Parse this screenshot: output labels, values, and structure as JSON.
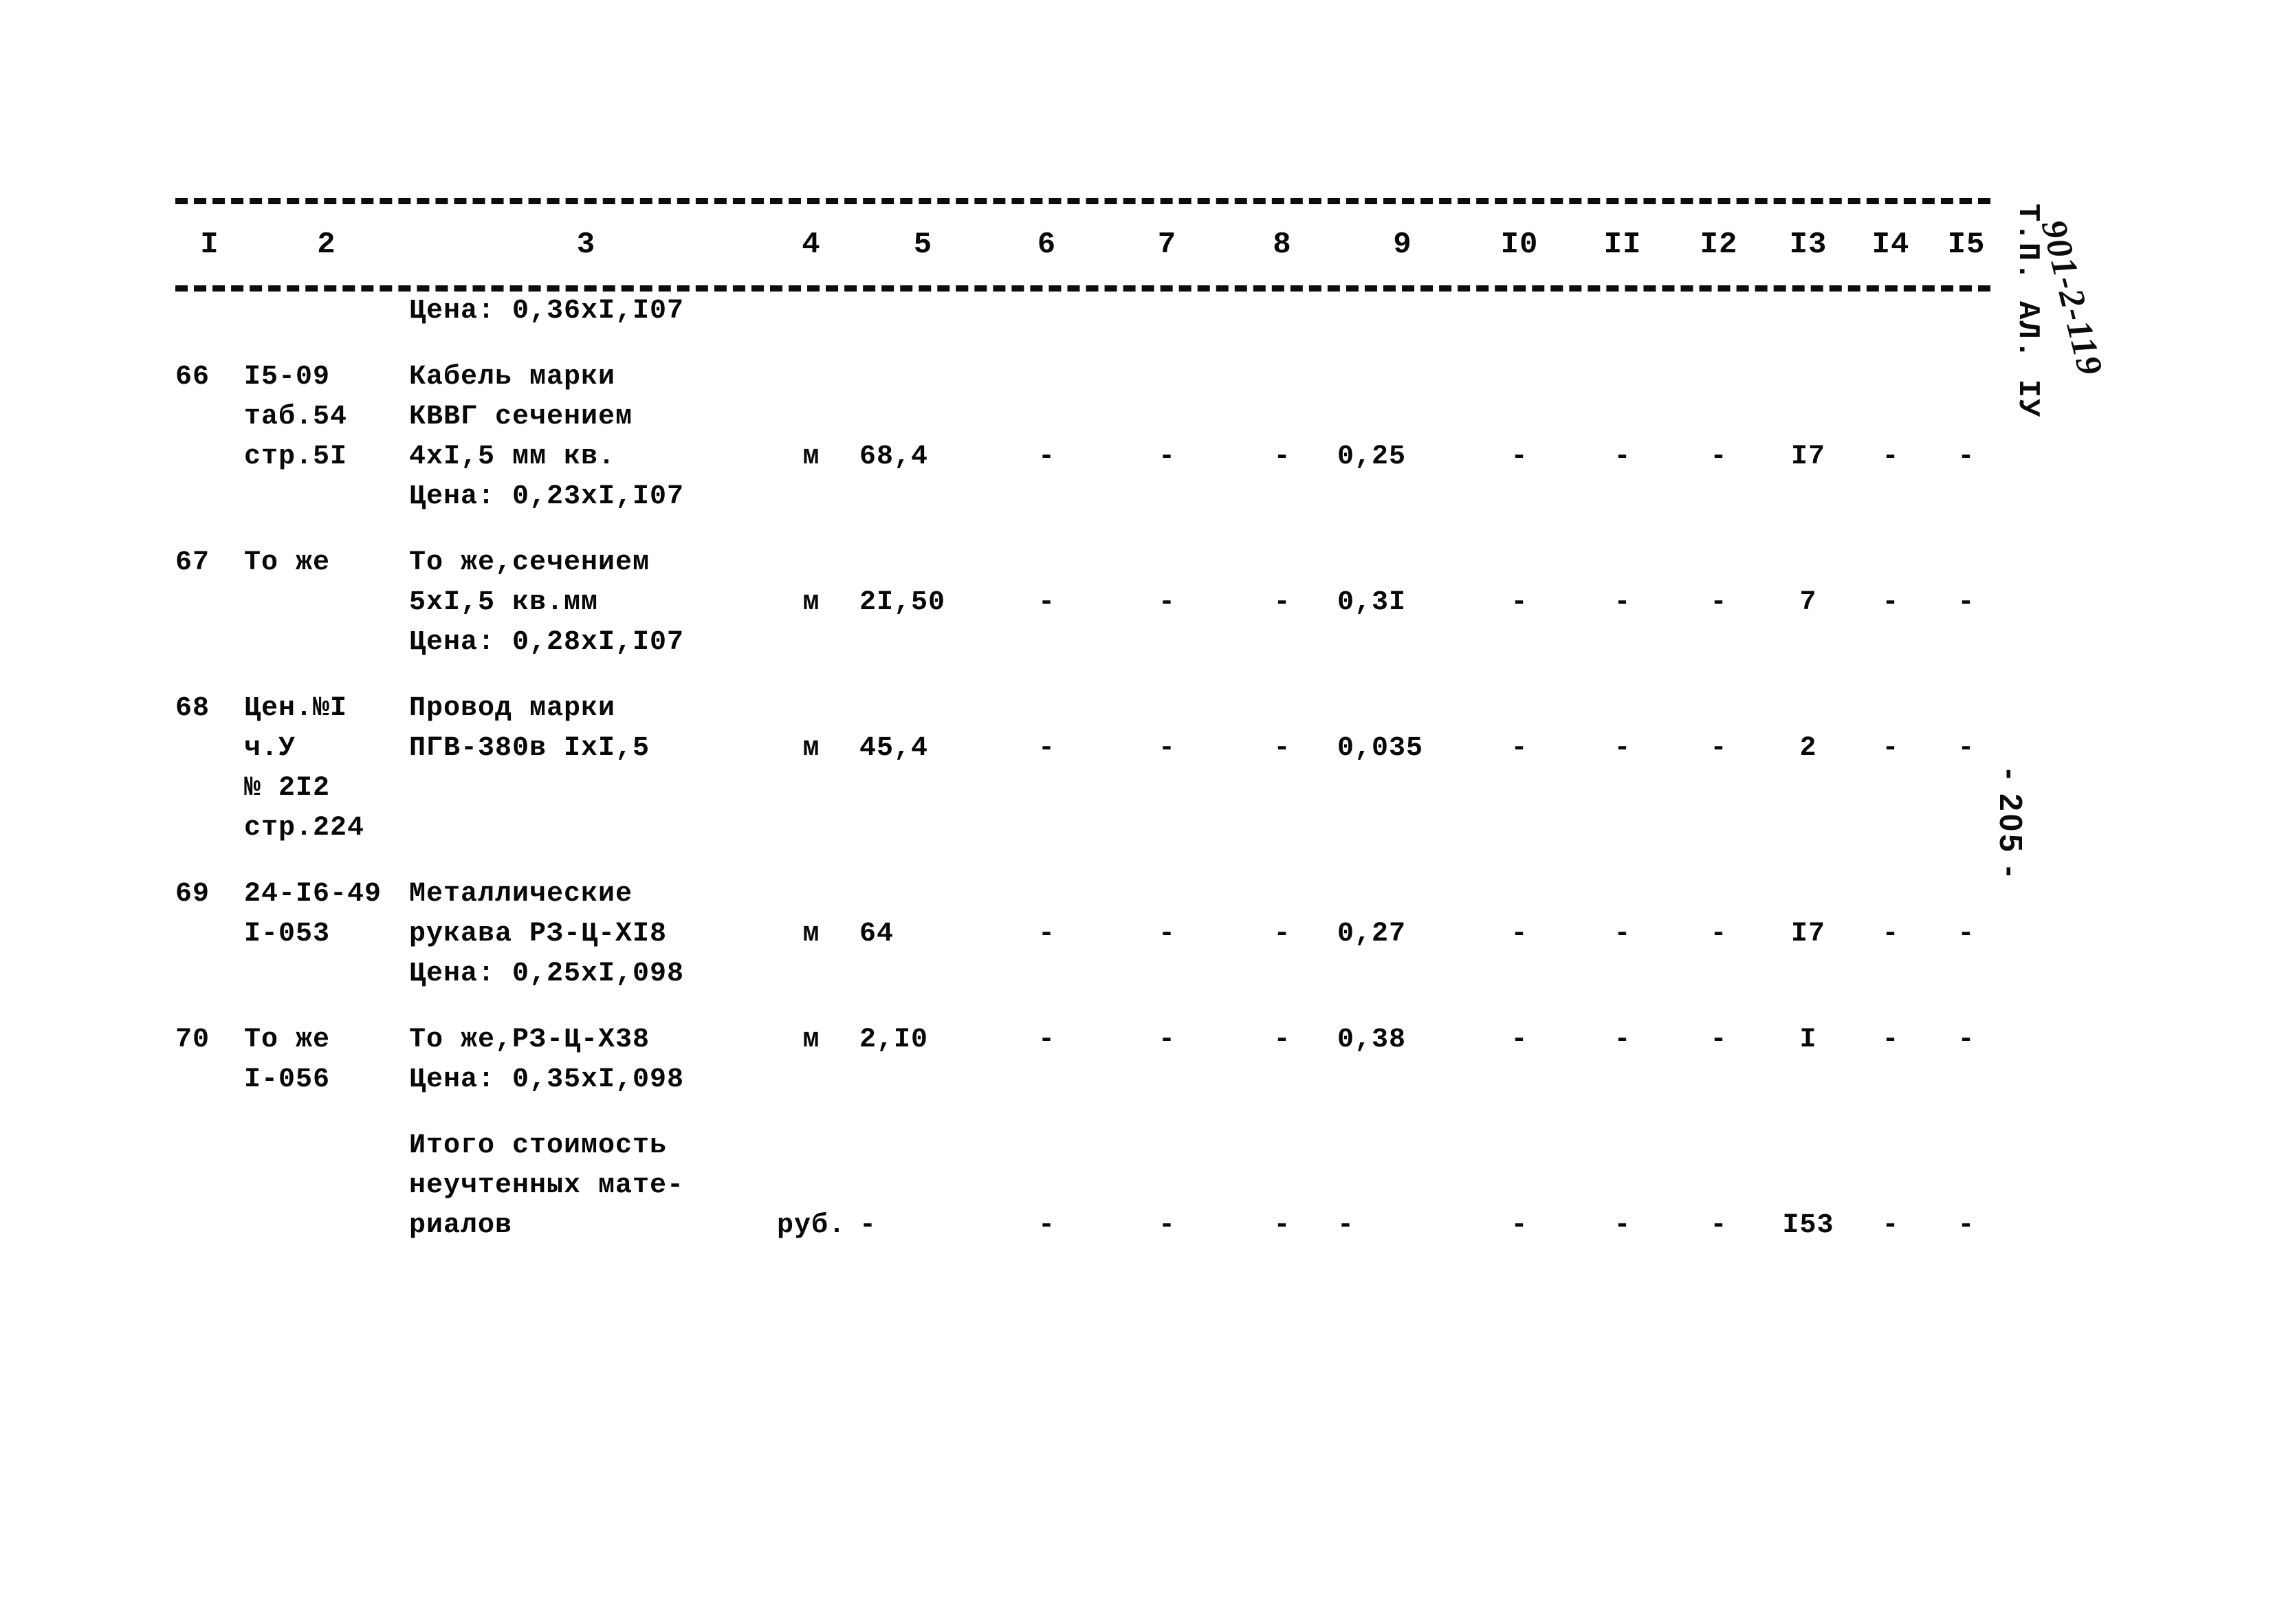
{
  "document": {
    "margin_label": "Т.П. АЛ. IУ",
    "handwritten_code": "901-2-119",
    "page_number": "- 205 -"
  },
  "table": {
    "column_headers": [
      "I",
      "2",
      "3",
      "4",
      "5",
      "6",
      "7",
      "8",
      "9",
      "I0",
      "II",
      "I2",
      "I3",
      "I4",
      "I5"
    ],
    "rows": [
      {
        "kind": "note",
        "c1": "",
        "c2": "",
        "c3": "Цена: 0,36xI,I07",
        "c4": "",
        "c5": "",
        "c6": "",
        "c7": "",
        "c8": "",
        "c9": "",
        "c10": "",
        "c11": "",
        "c12": "",
        "c13": "",
        "c14": "",
        "c15": ""
      },
      {
        "kind": "item",
        "c1": "66",
        "c2": "I5-09",
        "c3": "Кабель марки",
        "c4": "",
        "c5": "",
        "c6": "",
        "c7": "",
        "c8": "",
        "c9": "",
        "c10": "",
        "c11": "",
        "c12": "",
        "c13": "",
        "c14": "",
        "c15": ""
      },
      {
        "kind": "cont",
        "c1": "",
        "c2": "таб.54",
        "c3": "КВВГ сечением",
        "c4": "",
        "c5": "",
        "c6": "",
        "c7": "",
        "c8": "",
        "c9": "",
        "c10": "",
        "c11": "",
        "c12": "",
        "c13": "",
        "c14": "",
        "c15": ""
      },
      {
        "kind": "data",
        "c1": "",
        "c2": "стр.5I",
        "c3": "4xI,5 мм кв.",
        "c4": "м",
        "c5": "68,4",
        "c6": "-",
        "c7": "-",
        "c8": "-",
        "c9": "0,25",
        "c10": "-",
        "c11": "-",
        "c12": "-",
        "c13": "I7",
        "c14": "-",
        "c15": "-"
      },
      {
        "kind": "note",
        "c1": "",
        "c2": "",
        "c3": "Цена: 0,23xI,I07",
        "c4": "",
        "c5": "",
        "c6": "",
        "c7": "",
        "c8": "",
        "c9": "",
        "c10": "",
        "c11": "",
        "c12": "",
        "c13": "",
        "c14": "",
        "c15": ""
      },
      {
        "kind": "item",
        "c1": "67",
        "c2": "То же",
        "c3": "То же,сечением",
        "c4": "",
        "c5": "",
        "c6": "",
        "c7": "",
        "c8": "",
        "c9": "",
        "c10": "",
        "c11": "",
        "c12": "",
        "c13": "",
        "c14": "",
        "c15": ""
      },
      {
        "kind": "data",
        "c1": "",
        "c2": "",
        "c3": "5xI,5 кв.мм",
        "c4": "м",
        "c5": "2I,50",
        "c6": "-",
        "c7": "-",
        "c8": "-",
        "c9": "0,3I",
        "c10": "-",
        "c11": "-",
        "c12": "-",
        "c13": "7",
        "c14": "-",
        "c15": "-"
      },
      {
        "kind": "note",
        "c1": "",
        "c2": "",
        "c3": "Цена: 0,28xI,I07",
        "c4": "",
        "c5": "",
        "c6": "",
        "c7": "",
        "c8": "",
        "c9": "",
        "c10": "",
        "c11": "",
        "c12": "",
        "c13": "",
        "c14": "",
        "c15": ""
      },
      {
        "kind": "item",
        "c1": "68",
        "c2": "Цен.№I",
        "c3": "Провод марки",
        "c4": "",
        "c5": "",
        "c6": "",
        "c7": "",
        "c8": "",
        "c9": "",
        "c10": "",
        "c11": "",
        "c12": "",
        "c13": "",
        "c14": "",
        "c15": ""
      },
      {
        "kind": "data",
        "c1": "",
        "c2": "ч.У",
        "c3": "ПГВ-380в IxI,5",
        "c4": "м",
        "c5": "45,4",
        "c6": "-",
        "c7": "-",
        "c8": "-",
        "c9": "0,035",
        "c10": "-",
        "c11": "-",
        "c12": "-",
        "c13": "2",
        "c14": "-",
        "c15": "-"
      },
      {
        "kind": "cont",
        "c1": "",
        "c2": "№ 2I2",
        "c3": "",
        "c4": "",
        "c5": "",
        "c6": "",
        "c7": "",
        "c8": "",
        "c9": "",
        "c10": "",
        "c11": "",
        "c12": "",
        "c13": "",
        "c14": "",
        "c15": ""
      },
      {
        "kind": "cont",
        "c1": "",
        "c2": "стр.224",
        "c3": "",
        "c4": "",
        "c5": "",
        "c6": "",
        "c7": "",
        "c8": "",
        "c9": "",
        "c10": "",
        "c11": "",
        "c12": "",
        "c13": "",
        "c14": "",
        "c15": ""
      },
      {
        "kind": "item",
        "c1": "69",
        "c2": "24-I6-49",
        "c3": "Металлические",
        "c4": "",
        "c5": "",
        "c6": "",
        "c7": "",
        "c8": "",
        "c9": "",
        "c10": "",
        "c11": "",
        "c12": "",
        "c13": "",
        "c14": "",
        "c15": ""
      },
      {
        "kind": "data",
        "c1": "",
        "c2": "I-053",
        "c3": "рукава РЗ-Ц-XI8",
        "c4": "м",
        "c5": "64",
        "c6": "-",
        "c7": "-",
        "c8": "-",
        "c9": "0,27",
        "c10": "-",
        "c11": "-",
        "c12": "-",
        "c13": "I7",
        "c14": "-",
        "c15": "-"
      },
      {
        "kind": "note",
        "c1": "",
        "c2": "",
        "c3": "Цена: 0,25xI,098",
        "c4": "",
        "c5": "",
        "c6": "",
        "c7": "",
        "c8": "",
        "c9": "",
        "c10": "",
        "c11": "",
        "c12": "",
        "c13": "",
        "c14": "",
        "c15": ""
      },
      {
        "kind": "data",
        "c1": "70",
        "c2": "То же",
        "c3": "То же,РЗ-Ц-X38",
        "c4": "м",
        "c5": "2,I0",
        "c6": "-",
        "c7": "-",
        "c8": "-",
        "c9": "0,38",
        "c10": "-",
        "c11": "-",
        "c12": "-",
        "c13": "I",
        "c14": "-",
        "c15": "-"
      },
      {
        "kind": "note",
        "c1": "",
        "c2": "I-056",
        "c3": "Цена: 0,35xI,098",
        "c4": "",
        "c5": "",
        "c6": "",
        "c7": "",
        "c8": "",
        "c9": "",
        "c10": "",
        "c11": "",
        "c12": "",
        "c13": "",
        "c14": "",
        "c15": ""
      },
      {
        "kind": "total",
        "c1": "",
        "c2": "",
        "c3": "Итого стоимость",
        "c4": "",
        "c5": "",
        "c6": "",
        "c7": "",
        "c8": "",
        "c9": "",
        "c10": "",
        "c11": "",
        "c12": "",
        "c13": "",
        "c14": "",
        "c15": ""
      },
      {
        "kind": "total",
        "c1": "",
        "c2": "",
        "c3": "неучтенных мате-",
        "c4": "",
        "c5": "",
        "c6": "",
        "c7": "",
        "c8": "",
        "c9": "",
        "c10": "",
        "c11": "",
        "c12": "",
        "c13": "",
        "c14": "",
        "c15": ""
      },
      {
        "kind": "total",
        "c1": "",
        "c2": "",
        "c3": "риалов",
        "c4": "руб.",
        "c5": "-",
        "c6": "-",
        "c7": "-",
        "c8": "-",
        "c9": "-",
        "c10": "-",
        "c11": "-",
        "c12": "-",
        "c13": "I53",
        "c14": "-",
        "c15": "-"
      }
    ]
  }
}
